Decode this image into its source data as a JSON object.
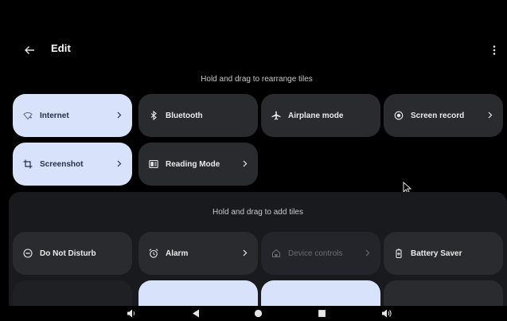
{
  "header": {
    "title": "Edit"
  },
  "current_tiles_hint": "Hold and drag to rearrange tiles",
  "current_tiles": [
    {
      "label": "Internet",
      "icon": "internet-icon",
      "active": true,
      "chevron": true
    },
    {
      "label": "Bluetooth",
      "icon": "bluetooth-icon",
      "active": false,
      "chevron": false
    },
    {
      "label": "Airplane mode",
      "icon": "airplane-icon",
      "active": false,
      "chevron": false
    },
    {
      "label": "Screen record",
      "icon": "screen-record-icon",
      "active": false,
      "chevron": true
    },
    {
      "label": "Screenshot",
      "icon": "screenshot-icon",
      "active": true,
      "chevron": true
    },
    {
      "label": "Reading Mode",
      "icon": "reading-mode-icon",
      "active": false,
      "chevron": true
    }
  ],
  "available_tiles_hint": "Hold and drag to add tiles",
  "available_tiles": [
    {
      "label": "Do Not Disturb",
      "icon": "do-not-disturb-icon",
      "active": false,
      "chevron": false
    },
    {
      "label": "Alarm",
      "icon": "alarm-icon",
      "active": false,
      "chevron": true
    },
    {
      "label": "Device controls",
      "icon": "device-controls-icon",
      "disabled": true,
      "chevron": true
    },
    {
      "label": "Battery Saver",
      "icon": "battery-saver-icon",
      "active": false,
      "chevron": false
    }
  ],
  "colors": {
    "background": "#000000",
    "tile": "#2a2b2f",
    "tile_active": "#d8e3fb",
    "panel": "#191a1d"
  }
}
